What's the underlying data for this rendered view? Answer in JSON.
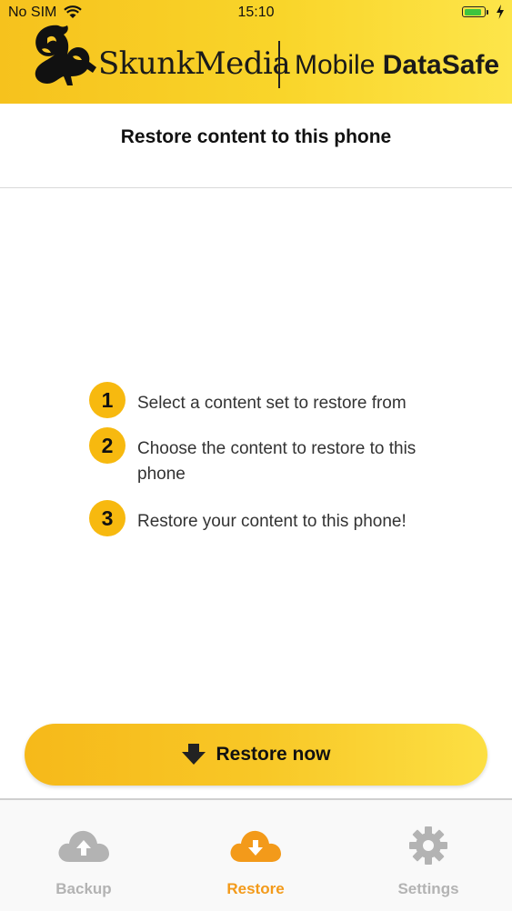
{
  "status_bar": {
    "carrier": "No SIM",
    "time": "15:10",
    "battery_level": 0.9
  },
  "brand": {
    "company": "SkunkMedia",
    "product_light": "Mobile",
    "product_bold": "DataSafe",
    "logo_icon": "skunk-logo"
  },
  "page": {
    "title": "Restore content to this phone"
  },
  "steps": [
    {
      "number": "1",
      "text": "Select a content set to restore from"
    },
    {
      "number": "2",
      "text": "Choose the content to restore to this phone"
    },
    {
      "number": "3",
      "text": "Restore your content to this phone!"
    }
  ],
  "restore_button": {
    "label": "Restore now",
    "icon": "arrow-down-icon"
  },
  "tabs": [
    {
      "label": "Backup",
      "icon": "cloud-upload-icon",
      "active": false
    },
    {
      "label": "Restore",
      "icon": "cloud-download-icon",
      "active": true
    },
    {
      "label": "Settings",
      "icon": "gear-icon",
      "active": false
    }
  ],
  "colors": {
    "brand_yellow": "#f8c726",
    "step_badge": "#f7b90f",
    "active_tab": "#f39a1a",
    "inactive_tab": "#b3b3b3"
  }
}
